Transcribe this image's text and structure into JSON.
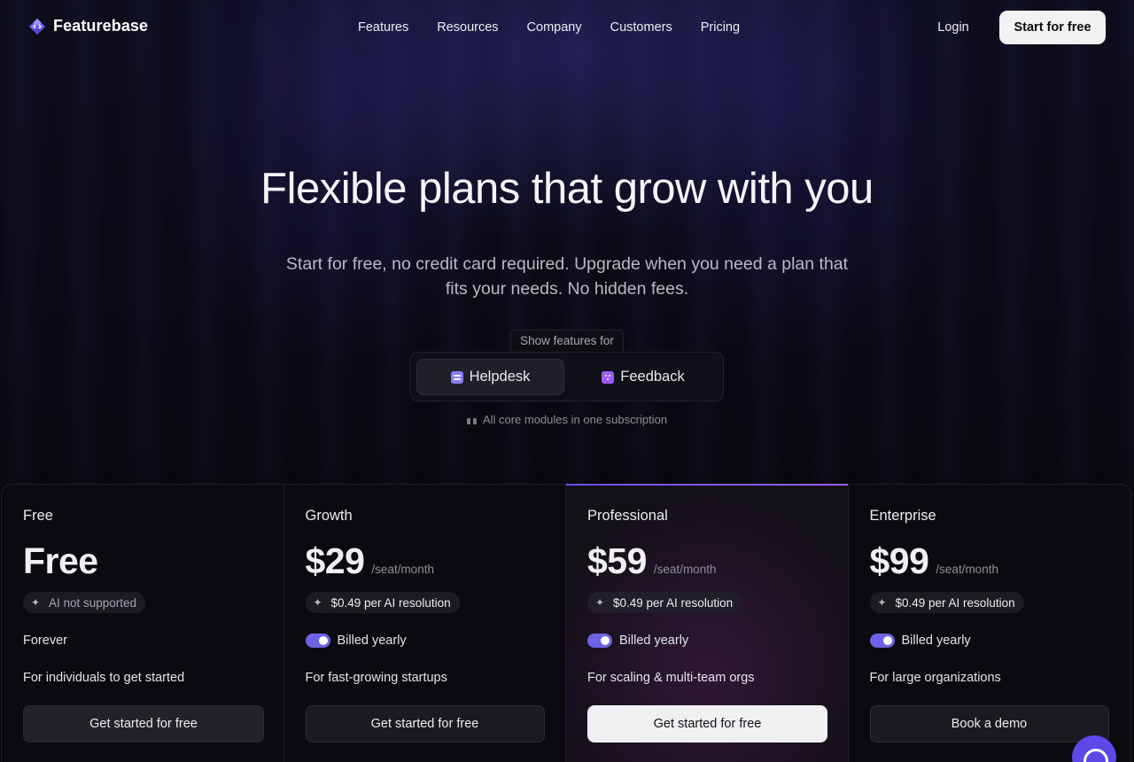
{
  "nav": {
    "brand": "Featurebase",
    "items": [
      "Features",
      "Resources",
      "Company",
      "Customers",
      "Pricing"
    ],
    "login": "Login",
    "cta": "Start for free"
  },
  "hero": {
    "title": "Flexible plans that grow with you",
    "subtitle": "Start for free, no credit card required. Upgrade when you need a plan that fits your needs. No hidden fees.",
    "show_label": "Show features for",
    "segments": [
      "Helpdesk",
      "Feedback"
    ],
    "active_segment": "Helpdesk",
    "core_note": "All core modules in one subscription"
  },
  "plans": [
    {
      "name": "Free",
      "price": "Free",
      "per": "",
      "ai": "AI not supported",
      "billing": "Forever",
      "desc": "For individuals to get started",
      "cta": "Get started for free"
    },
    {
      "name": "Growth",
      "price": "$29",
      "per": "/seat/month",
      "ai": "$0.49 per AI resolution",
      "billing": "Billed yearly",
      "billed_yearly": true,
      "desc": "For fast-growing startups",
      "cta": "Get started for free"
    },
    {
      "name": "Professional",
      "price": "$59",
      "per": "/seat/month",
      "ai": "$0.49 per AI resolution",
      "billing": "Billed yearly",
      "billed_yearly": true,
      "desc": "For scaling & multi-team orgs",
      "cta": "Get started for free"
    },
    {
      "name": "Enterprise",
      "price": "$99",
      "per": "/seat/month",
      "ai": "$0.49 per AI resolution",
      "billing": "Billed yearly",
      "billed_yearly": true,
      "desc": "For large organizations",
      "cta": "Book a demo"
    }
  ],
  "colors": {
    "accent": "#6d63e6",
    "brand": "#7b6cf0",
    "background": "#07070b"
  }
}
